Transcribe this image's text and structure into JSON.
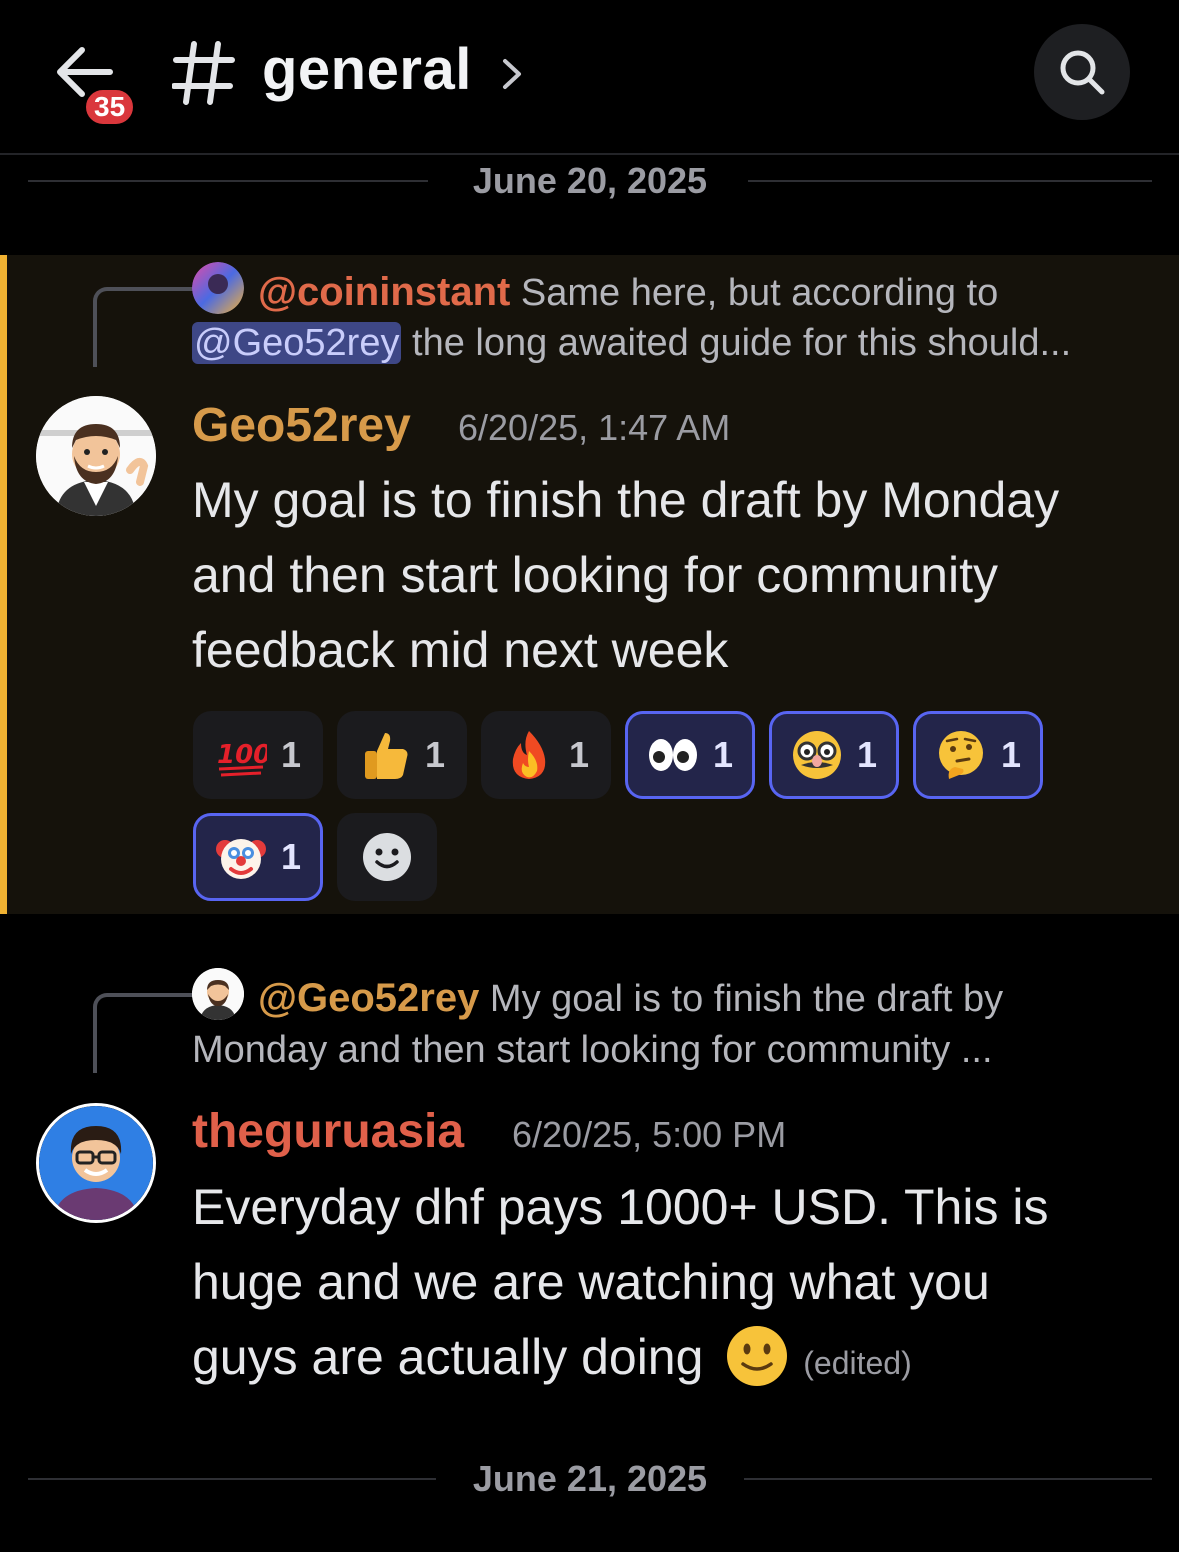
{
  "header": {
    "unread_count": "35",
    "channel_name": "general"
  },
  "dates": [
    "June 20, 2025",
    "June 21, 2025"
  ],
  "messages": [
    {
      "reply": {
        "name": "@coininstant",
        "text_line1": "Same here, but according to",
        "mention": "@Geo52rey",
        "text_line2": " the long awaited guide for this should..."
      },
      "author": "Geo52rey",
      "timestamp": "6/20/25, 1:47 AM",
      "lines": [
        "My goal is to finish the draft by Monday",
        "and then start looking for community",
        "feedback mid next week"
      ],
      "reactions": [
        {
          "emoji": "hundred-points",
          "count": "1",
          "me": false
        },
        {
          "emoji": "thumbs-up",
          "count": "1",
          "me": false
        },
        {
          "emoji": "fire",
          "count": "1",
          "me": false
        },
        {
          "emoji": "eyes",
          "count": "1",
          "me": true
        },
        {
          "emoji": "disguised-face",
          "count": "1",
          "me": true
        },
        {
          "emoji": "thinking-face",
          "count": "1",
          "me": true
        },
        {
          "emoji": "clown-face",
          "count": "1",
          "me": true
        }
      ]
    },
    {
      "reply": {
        "name": "@Geo52rey",
        "text_line1": "My goal is to finish the draft by",
        "text_line2": "Monday and then start looking for community ..."
      },
      "author": "theguruasia",
      "timestamp": "6/20/25, 5:00 PM",
      "lines": [
        "Everyday dhf pays 1000+ USD. This is",
        "huge and we are watching what you",
        "guys are actually doing"
      ],
      "edited": "(edited)"
    }
  ],
  "colors": {
    "highlight_bar": "#f0b232",
    "geo_name": "#d69a4a",
    "guru_name": "#e0604a",
    "mention_bg": "#3e4786",
    "badge": "#da373c"
  }
}
